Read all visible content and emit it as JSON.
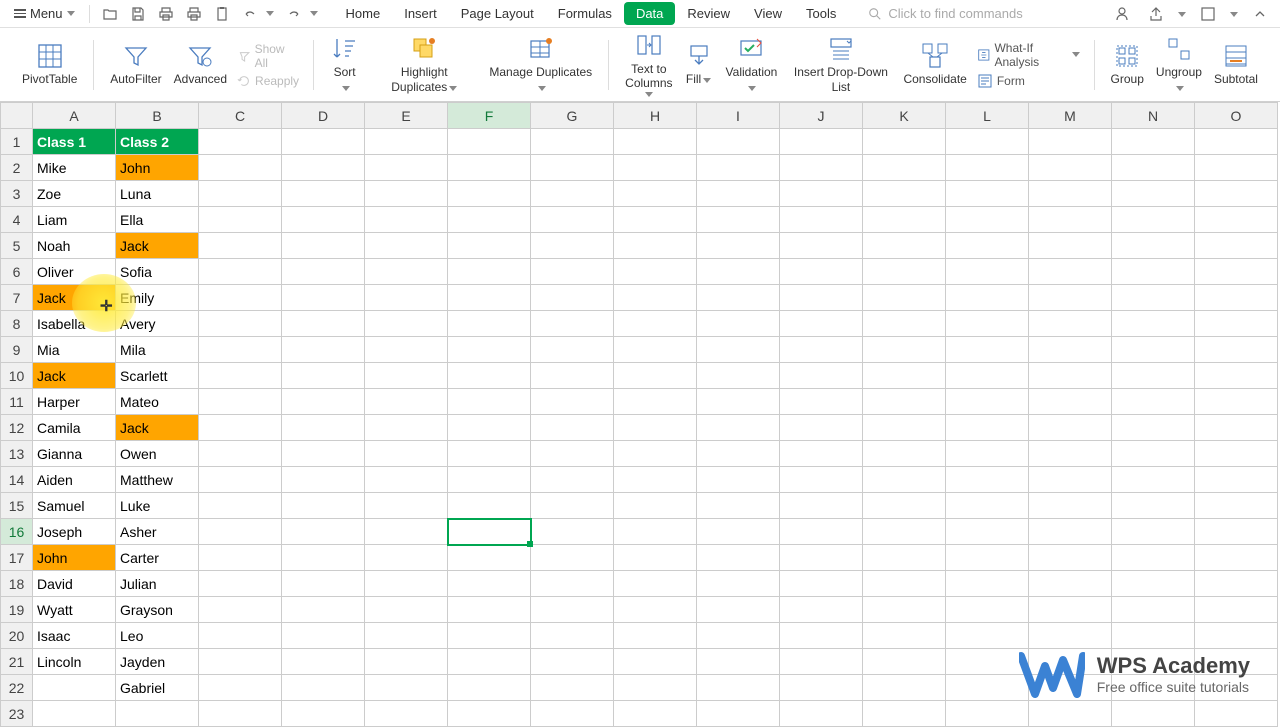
{
  "menubar": {
    "menu_label": "Menu",
    "search_placeholder": "Click to find commands"
  },
  "tabs": [
    "Home",
    "Insert",
    "Page Layout",
    "Formulas",
    "Data",
    "Review",
    "View",
    "Tools"
  ],
  "active_tab": "Data",
  "ribbon": {
    "pivottable": "PivotTable",
    "autofilter": "AutoFilter",
    "advanced": "Advanced",
    "showall": "Show All",
    "reapply": "Reapply",
    "sort": "Sort",
    "highlight_dup": "Highlight Duplicates",
    "manage_dup": "Manage Duplicates",
    "text_to_cols": "Text to\nColumns",
    "fill": "Fill",
    "validation": "Validation",
    "insert_dd": "Insert Drop-Down List",
    "consolidate": "Consolidate",
    "whatif": "What-If Analysis",
    "form": "Form",
    "group": "Group",
    "ungroup": "Ungroup",
    "subtotal": "Subtotal"
  },
  "columns": [
    "A",
    "B",
    "C",
    "D",
    "E",
    "F",
    "G",
    "H",
    "I",
    "J",
    "K",
    "L",
    "M",
    "N",
    "O"
  ],
  "selected_col": "F",
  "selected_row": 16,
  "active_cell": "F16",
  "rows": [
    {
      "n": 1,
      "a": "Class 1",
      "b": "Class 2",
      "hdr": true
    },
    {
      "n": 2,
      "a": "Mike",
      "b": "John",
      "b_hl": true
    },
    {
      "n": 3,
      "a": "Zoe",
      "b": "Luna"
    },
    {
      "n": 4,
      "a": "Liam",
      "b": "Ella"
    },
    {
      "n": 5,
      "a": "Noah",
      "b": "Jack",
      "b_hl": true
    },
    {
      "n": 6,
      "a": "Oliver",
      "b": "Sofia"
    },
    {
      "n": 7,
      "a": "Jack",
      "b": "Emily",
      "a_hl": true
    },
    {
      "n": 8,
      "a": "Isabella",
      "b": "Avery"
    },
    {
      "n": 9,
      "a": "Mia",
      "b": "Mila"
    },
    {
      "n": 10,
      "a": "Jack",
      "b": "Scarlett",
      "a_hl": true
    },
    {
      "n": 11,
      "a": "Harper",
      "b": "Mateo"
    },
    {
      "n": 12,
      "a": "Camila",
      "b": "Jack",
      "b_hl": true
    },
    {
      "n": 13,
      "a": "Gianna",
      "b": "Owen"
    },
    {
      "n": 14,
      "a": "Aiden",
      "b": "Matthew"
    },
    {
      "n": 15,
      "a": "Samuel",
      "b": "Luke"
    },
    {
      "n": 16,
      "a": "Joseph",
      "b": "Asher"
    },
    {
      "n": 17,
      "a": "John",
      "b": "Carter",
      "a_hl": true
    },
    {
      "n": 18,
      "a": "David",
      "b": "Julian"
    },
    {
      "n": 19,
      "a": "Wyatt",
      "b": "Grayson"
    },
    {
      "n": 20,
      "a": "Isaac",
      "b": "Leo"
    },
    {
      "n": 21,
      "a": "Lincoln",
      "b": "Jayden"
    },
    {
      "n": 22,
      "a": "",
      "b": "Gabriel"
    },
    {
      "n": 23,
      "a": "",
      "b": ""
    }
  ],
  "watermark": {
    "title": "WPS Academy",
    "subtitle": "Free office suite tutorials"
  }
}
